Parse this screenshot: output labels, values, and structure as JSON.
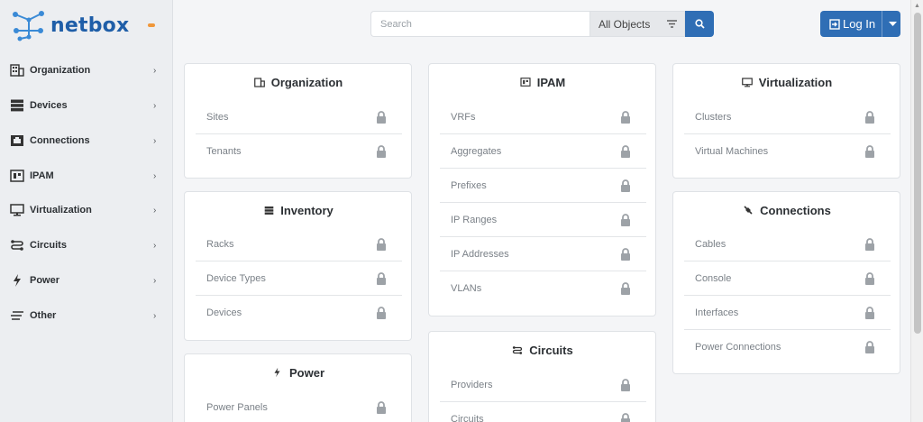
{
  "brand": {
    "name": "netbox",
    "logo_icon": "netbox-logo-icon",
    "accent": "#1f5ea8"
  },
  "sidebar": {
    "items": [
      {
        "label": "Organization",
        "icon": "building-icon"
      },
      {
        "label": "Devices",
        "icon": "server-icon"
      },
      {
        "label": "Connections",
        "icon": "ethernet-icon"
      },
      {
        "label": "IPAM",
        "icon": "ipam-icon"
      },
      {
        "label": "Virtualization",
        "icon": "monitor-icon"
      },
      {
        "label": "Circuits",
        "icon": "transit-icon"
      },
      {
        "label": "Power",
        "icon": "flash-icon"
      },
      {
        "label": "Other",
        "icon": "other-icon"
      }
    ]
  },
  "search": {
    "placeholder": "Search",
    "object_type": "All Objects"
  },
  "login": {
    "label": "Log In"
  },
  "colors": {
    "primary": "#2f6eb5",
    "lock": "#9da2a7"
  },
  "cards": {
    "organization": {
      "title": "Organization",
      "rows": [
        "Sites",
        "Tenants"
      ]
    },
    "inventory": {
      "title": "Inventory",
      "rows": [
        "Racks",
        "Device Types",
        "Devices"
      ]
    },
    "power": {
      "title": "Power",
      "rows": [
        "Power Panels"
      ]
    },
    "ipam": {
      "title": "IPAM",
      "rows": [
        "VRFs",
        "Aggregates",
        "Prefixes",
        "IP Ranges",
        "IP Addresses",
        "VLANs"
      ]
    },
    "circuits": {
      "title": "Circuits",
      "rows": [
        "Providers",
        "Circuits"
      ]
    },
    "virtualization": {
      "title": "Virtualization",
      "rows": [
        "Clusters",
        "Virtual Machines"
      ]
    },
    "connections": {
      "title": "Connections",
      "rows": [
        "Cables",
        "Console",
        "Interfaces",
        "Power Connections"
      ]
    }
  }
}
